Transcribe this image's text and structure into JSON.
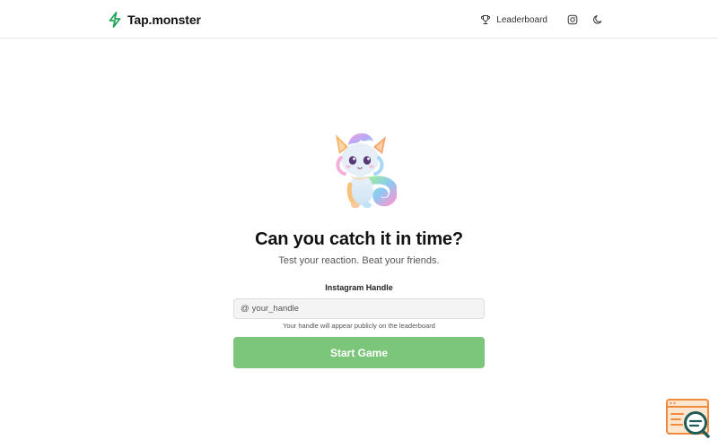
{
  "header": {
    "brand_name": "Tap.monster",
    "brand_icon": "lightning-bolt-icon",
    "nav": {
      "leaderboard_label": "Leaderboard",
      "leaderboard_icon": "trophy-icon",
      "instagram_icon": "instagram-icon",
      "theme_icon": "moon-icon"
    }
  },
  "hero": {
    "mascot_icon": "rainbow-cat-monster-mascot",
    "title": "Can you catch it in time?",
    "subtitle": "Test your reaction. Beat your friends."
  },
  "form": {
    "label": "Instagram Handle",
    "prefix": "@",
    "placeholder": "your_handle",
    "value": "",
    "help": "Your handle will appear publicly on the leaderboard",
    "submit_label": "Start Game"
  },
  "floating_widget": {
    "icon": "chat-search-widget-icon"
  },
  "colors": {
    "accent_green": "#22a559",
    "button_green": "#7cc67b",
    "widget_orange": "#f08a3c"
  }
}
